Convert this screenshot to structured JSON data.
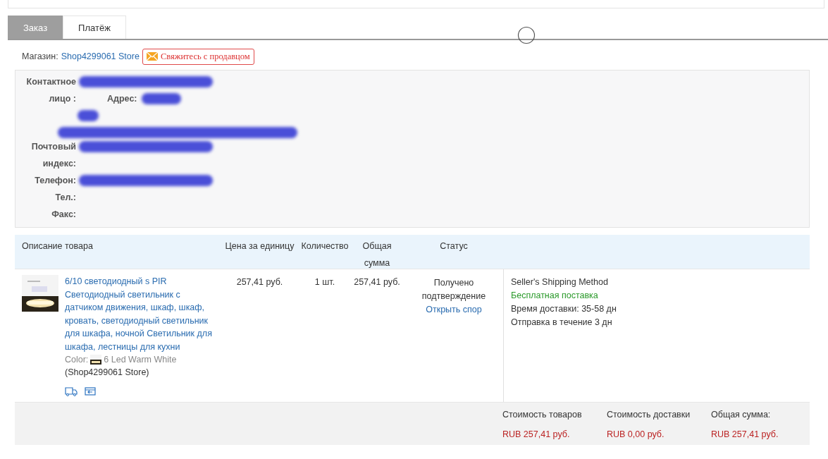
{
  "tabs": [
    {
      "label": "Заказ",
      "selected": true
    },
    {
      "label": "Платёж",
      "selected": false
    }
  ],
  "store": {
    "label": "Магазин:",
    "name": "Shop4299061 Store",
    "contact_button": "Свяжитесь с продавцом"
  },
  "contact": {
    "fields": [
      {
        "label": "Контактное лицо :",
        "redacted": true,
        "sub_label": "Адрес:",
        "sub_redacted": true
      },
      {
        "label": "Почтовый индекс:",
        "redacted": true
      },
      {
        "label": "Телефон:",
        "redacted": true
      },
      {
        "label": "Тел.:",
        "redacted": false
      },
      {
        "label": "Факс:",
        "redacted": false
      }
    ]
  },
  "table": {
    "columns": [
      "Описание товара",
      "Цена за единицу",
      "Количество",
      "Общая сумма",
      "Статус"
    ],
    "rows": [
      {
        "title": "6/10 светодиодный s PIR Светодиодный светильник с датчиком движения, шкаф, шкаф, кровать, светодиодный светильник для шкафа, ночной Светильник для шкафа, лестницы для кухни",
        "color_label": "Color:",
        "color_value": "6 Led Warm White",
        "store": "(Shop4299061 Store)",
        "price": "257,41 руб.",
        "quantity": "1 шт.",
        "total": "257,41 руб.",
        "status": "Получено подтверждение",
        "dispute_link": "Открыть спор",
        "shipping": [
          {
            "text": "Seller's Shipping Method",
            "kind": "plain"
          },
          {
            "text": "Бесплатная поставка",
            "kind": "free"
          },
          {
            "text": "Время доставки: 35-58 дн",
            "kind": "plain"
          },
          {
            "text": "Отправка в течение 3 дн",
            "kind": "plain"
          }
        ]
      }
    ]
  },
  "summary": [
    {
      "label": "Стоимость товаров",
      "value": "RUB 257,41 руб."
    },
    {
      "label": "Стоимость доставки",
      "value": "RUB 0,00 руб."
    },
    {
      "label": "Общая сумма:",
      "value": "RUB 257,41 руб."
    }
  ]
}
